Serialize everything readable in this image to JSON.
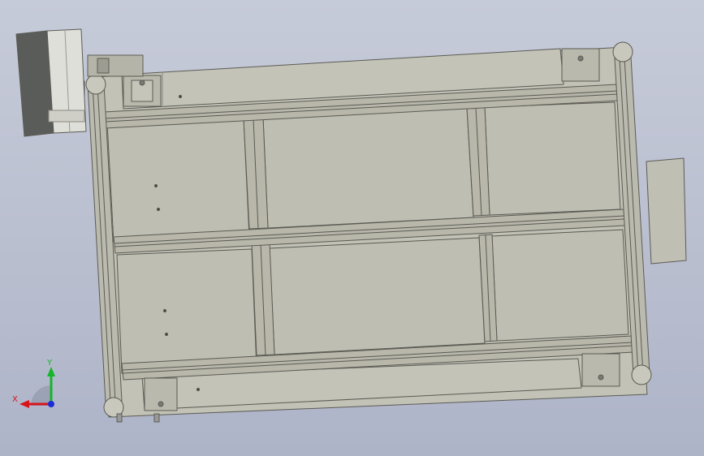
{
  "viewport": {
    "background_top": "#c6cbd9",
    "background_bottom": "#aeb4c8"
  },
  "model": {
    "body_color": "#c3c2b6",
    "panel_color": "#bfbeb2",
    "rail_color": "#b8b7aa",
    "edge_color": "#5b5b55",
    "motor_dark_color": "#5a5c59",
    "motor_light_color": "#dedfd8"
  },
  "triad": {
    "x_label": "X",
    "y_label": "Y",
    "x_color": "#d8141b",
    "y_color": "#14b52a",
    "z_color": "#1d2bd6"
  }
}
